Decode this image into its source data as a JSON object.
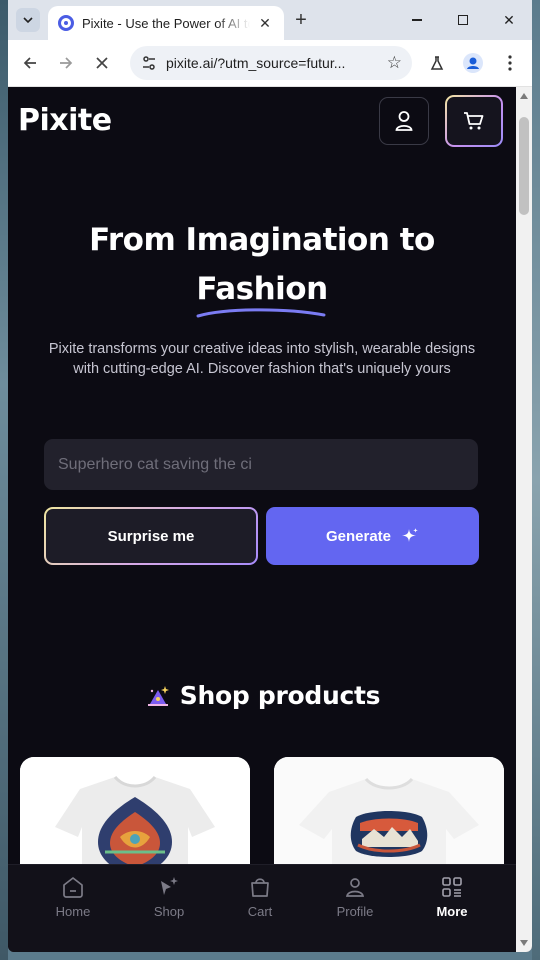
{
  "browser": {
    "tab_title": "Pixite - Use the Power of AI to Design Fashion",
    "url": "pixite.ai/?utm_source=futur...",
    "new_tab_label": "+"
  },
  "page": {
    "logo": "Pixite",
    "hero": {
      "title_line1": "From Imagination to",
      "title_line2": "Fashion",
      "subtitle": "Pixite transforms your creative ideas into stylish, wearable designs with cutting-edge AI. Discover fashion that's uniquely yours"
    },
    "prompt": {
      "placeholder": "Superhero cat saving the ci"
    },
    "buttons": {
      "surprise": "Surprise me",
      "generate": "Generate"
    },
    "shop": {
      "title": "Shop products"
    },
    "nav": [
      {
        "label": "Home",
        "icon": "home-icon"
      },
      {
        "label": "Shop",
        "icon": "sparkle-shop-icon"
      },
      {
        "label": "Cart",
        "icon": "bag-icon"
      },
      {
        "label": "Profile",
        "icon": "user-icon"
      },
      {
        "label": "More",
        "icon": "grid-icon",
        "active": true
      }
    ],
    "colors": {
      "background": "#0c0b13",
      "accent": "#6366f1",
      "input_bg": "#22212c"
    }
  }
}
